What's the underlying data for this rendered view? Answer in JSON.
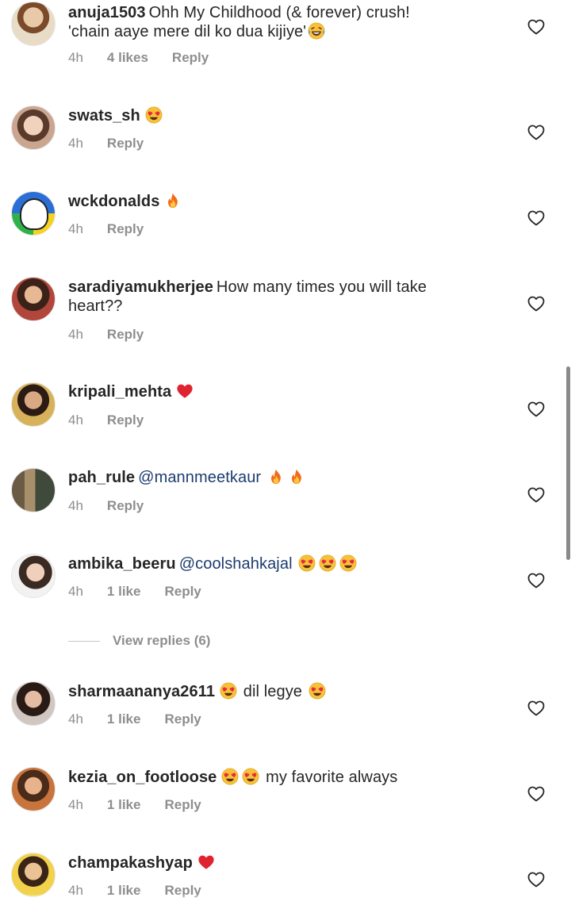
{
  "comments": [
    {
      "username": "anuja1503",
      "text_parts": [
        "Ohh My Childhood (& forever) crush!",
        "'chain aaye mere dil ko dua kijiye'"
      ],
      "emojis": [
        "laughing-tears"
      ],
      "time": "4h",
      "likes": "4 likes",
      "reply": "Reply"
    },
    {
      "username": "swats_sh",
      "text": "",
      "emojis": [
        "heart-eyes"
      ],
      "time": "4h",
      "reply": "Reply"
    },
    {
      "username": "wckdonalds",
      "text": "",
      "emojis": [
        "fire"
      ],
      "time": "4h",
      "reply": "Reply"
    },
    {
      "username": "saradiyamukherjee",
      "text": "How many times you will take",
      "text2": "heart??",
      "time": "4h",
      "reply": "Reply"
    },
    {
      "username": "kripali_mehta",
      "text": "",
      "emojis": [
        "red-heart"
      ],
      "time": "4h",
      "reply": "Reply"
    },
    {
      "username": "pah_rule",
      "mention": "@mannmeetkaur",
      "emojis": [
        "fire",
        "fire"
      ],
      "time": "4h",
      "reply": "Reply"
    },
    {
      "username": "ambika_beeru",
      "mention": "@coolshahkajal",
      "emojis": [
        "heart-eyes",
        "heart-eyes",
        "heart-eyes"
      ],
      "time": "4h",
      "likes": "1 like",
      "reply": "Reply"
    },
    {
      "username": "sharmaananya2611",
      "text": "dil legye",
      "emojis": [
        "heart-eyes",
        "heart-eyes"
      ],
      "time": "4h",
      "likes": "1 like",
      "reply": "Reply"
    },
    {
      "username": "kezia_on_footloose",
      "text": "my favorite always",
      "emojis": [
        "heart-eyes",
        "heart-eyes"
      ],
      "time": "4h",
      "likes": "1 like",
      "reply": "Reply"
    },
    {
      "username": "champakashyap",
      "text": "",
      "emojis": [
        "red-heart"
      ],
      "time": "4h",
      "likes": "1 like",
      "reply": "Reply"
    }
  ],
  "view_replies": "View replies (6)",
  "colors": {
    "username": "#262626",
    "meta": "#8e8e8e",
    "mention": "#1d3c6e",
    "background": "#ffffff"
  },
  "icons": {
    "like": "heart-outline-icon"
  }
}
